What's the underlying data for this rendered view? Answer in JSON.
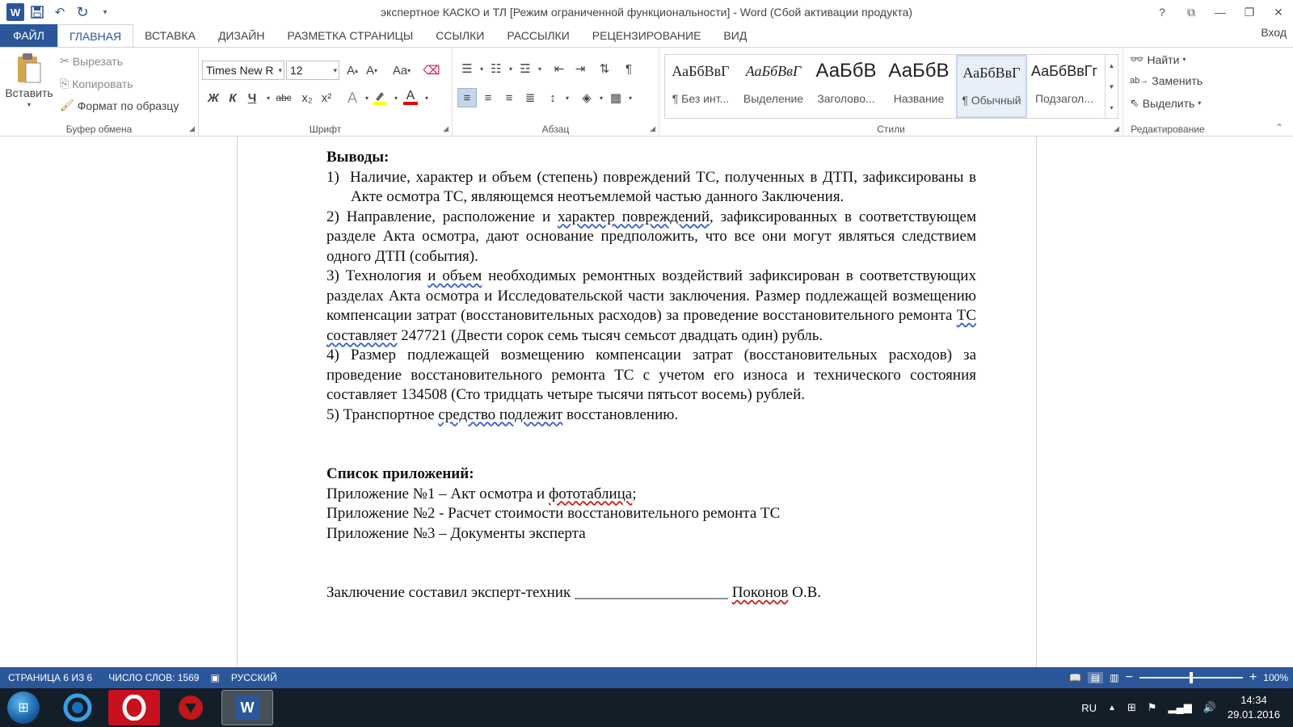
{
  "window": {
    "title": "экспертное КАСКО и ТЛ [Режим ограниченной функциональности] - Word (Сбой активации продукта)",
    "help": "?",
    "app_icon": "W"
  },
  "tabs": [
    {
      "label": "ФАЙЛ"
    },
    {
      "label": "ГЛАВНАЯ"
    },
    {
      "label": "ВСТАВКА"
    },
    {
      "label": "ДИЗАЙН"
    },
    {
      "label": "РАЗМЕТКА СТРАНИЦЫ"
    },
    {
      "label": "ССЫЛКИ"
    },
    {
      "label": "РАССЫЛКИ"
    },
    {
      "label": "РЕЦЕНЗИРОВАНИЕ"
    },
    {
      "label": "ВИД"
    }
  ],
  "login": "Вход",
  "clipboard": {
    "paste": "Вставить",
    "cut": "Вырезать",
    "copy": "Копировать",
    "format_painter": "Формат по образцу",
    "group_label": "Буфер обмена"
  },
  "font": {
    "family": "Times New R",
    "size": "12",
    "group_label": "Шрифт",
    "change_case": "Aa",
    "bold": "Ж",
    "italic": "К",
    "underline": "Ч",
    "strike": "abc",
    "subscript": "x₂",
    "superscript": "x²",
    "text_effects": "A",
    "font_color_glyph": "A"
  },
  "paragraph": {
    "group_label": "Абзац",
    "pilcrow": "¶"
  },
  "styles": {
    "group_label": "Стили",
    "items": [
      {
        "preview": "АаБбВвГ",
        "name": "¶ Без инт..."
      },
      {
        "preview": "АаБбВвГ",
        "name": "Выделение"
      },
      {
        "preview": "АаБбВ",
        "name": "Заголово..."
      },
      {
        "preview": "АаБбВ",
        "name": "Название"
      },
      {
        "preview": "АаБбВвГ",
        "name": "¶ Обычный"
      },
      {
        "preview": "АаБбВвГг",
        "name": "Подзагол..."
      }
    ]
  },
  "editing": {
    "find": "Найти",
    "replace": "Заменить",
    "select": "Выделить",
    "group_label": "Редактирование"
  },
  "document": {
    "heading1": "Выводы:",
    "item1": "1)  Наличие, характер и объем (степень) повреждений ТС, полученных в ДТП, зафиксированы в Акте осмотра ТС, являющемся неотъемлемой частью данного Заключения.",
    "item2_a": "2) Направление, расположение и ",
    "item2_sq": "характер  повреждений",
    "item2_b": ", зафиксированных в соответствующем разделе Акта осмотра,   дают основание предположить, что все они могут являться следствием одного ДТП (события).",
    "item3_a": " 3) Технология ",
    "item3_sq": "и  объем",
    "item3_b": "  необходимых ремонтных воздействий зафиксирован в соответствующих разделах Акта осмотра и  Исследовательской части заключения. Размер подлежащей возмещению компенсации затрат (восстановительных расходов) за проведение восстановительного ремонта ",
    "item3_sq2": "ТС  составляет",
    "item3_c": " 247721 (Двести сорок семь тысяч семьсот двадцать один) рубль.",
    "item4": " 4)  Размер подлежащей возмещению компенсации затрат (восстановительных расходов) за проведение восстановительного ремонта ТС с учетом его износа и технического состояния составляет 134508 (Сто тридцать четыре тысячи пятьсот восемь) рублей.",
    "item5_a": " 5)  Транспортное ",
    "item5_sq": "средство  подлежит",
    "item5_b": " восстановлению.",
    "heading2": "Список приложений:",
    "app1_a": "Приложение №1 – Акт осмотра и ",
    "app1_sq": "фототаблица",
    "app1_b": ";",
    "app2": "Приложение №2 - Расчет стоимости восстановительного ремонта ТС",
    "app3": "Приложение №3 – Документы эксперта",
    "signature_a": "Заключение составил эксперт-техник ____________________ ",
    "signature_sq": "Поконов",
    "signature_b": " О.В."
  },
  "status": {
    "page": "СТРАНИЦА 6 ИЗ 6",
    "words": "ЧИСЛО СЛОВ: 1569",
    "language": "РУССКИЙ",
    "zoom": "100%",
    "zoom_level": 1.0
  },
  "taskbar": {
    "lang": "RU",
    "time": "14:34",
    "date": "29.01.2016"
  },
  "colors": {
    "accent": "#2b579a",
    "taskbar": "#141e28"
  }
}
